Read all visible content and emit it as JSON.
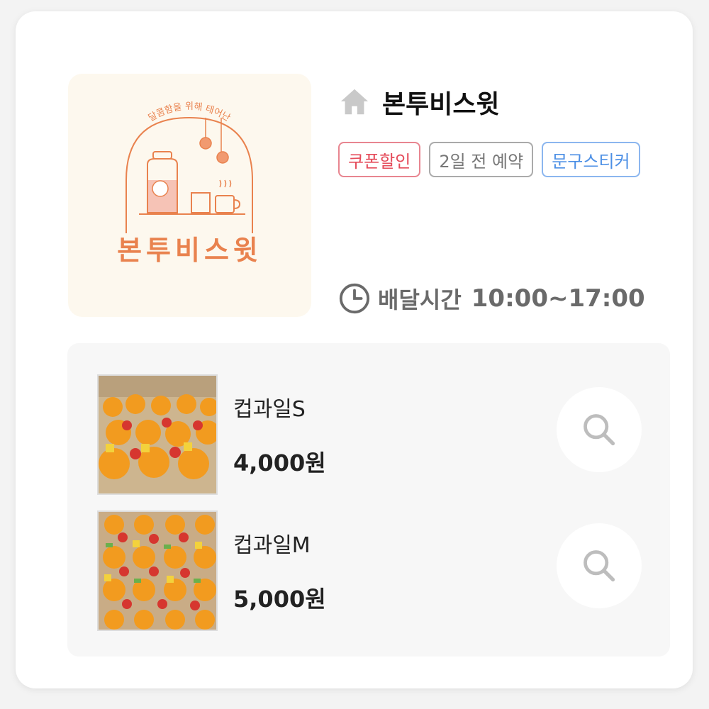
{
  "store": {
    "logo_name": "본투비스윗",
    "logo_tagline": "· 달콤함을 위해 태어난 ·",
    "name": "본투비스윗",
    "home_icon": "home-icon",
    "tags": [
      {
        "label": "쿠폰할인",
        "color": "#e54b5a"
      },
      {
        "label": "2일 전 예약",
        "color": "#777777"
      },
      {
        "label": "문구스티커",
        "color": "#4c8fe5"
      }
    ],
    "delivery_icon": "clock-icon",
    "delivery_label": "배달시간",
    "delivery_time": "10:00~17:00"
  },
  "menu": [
    {
      "name": "컵과일S",
      "price": "4,000원",
      "action_icon": "search-icon"
    },
    {
      "name": "컵과일M",
      "price": "5,000원",
      "action_icon": "search-icon"
    }
  ],
  "colors": {
    "brand_orange": "#e9824e",
    "coupon_red": "#e54b5a",
    "sticker_blue": "#4c8fe5"
  }
}
